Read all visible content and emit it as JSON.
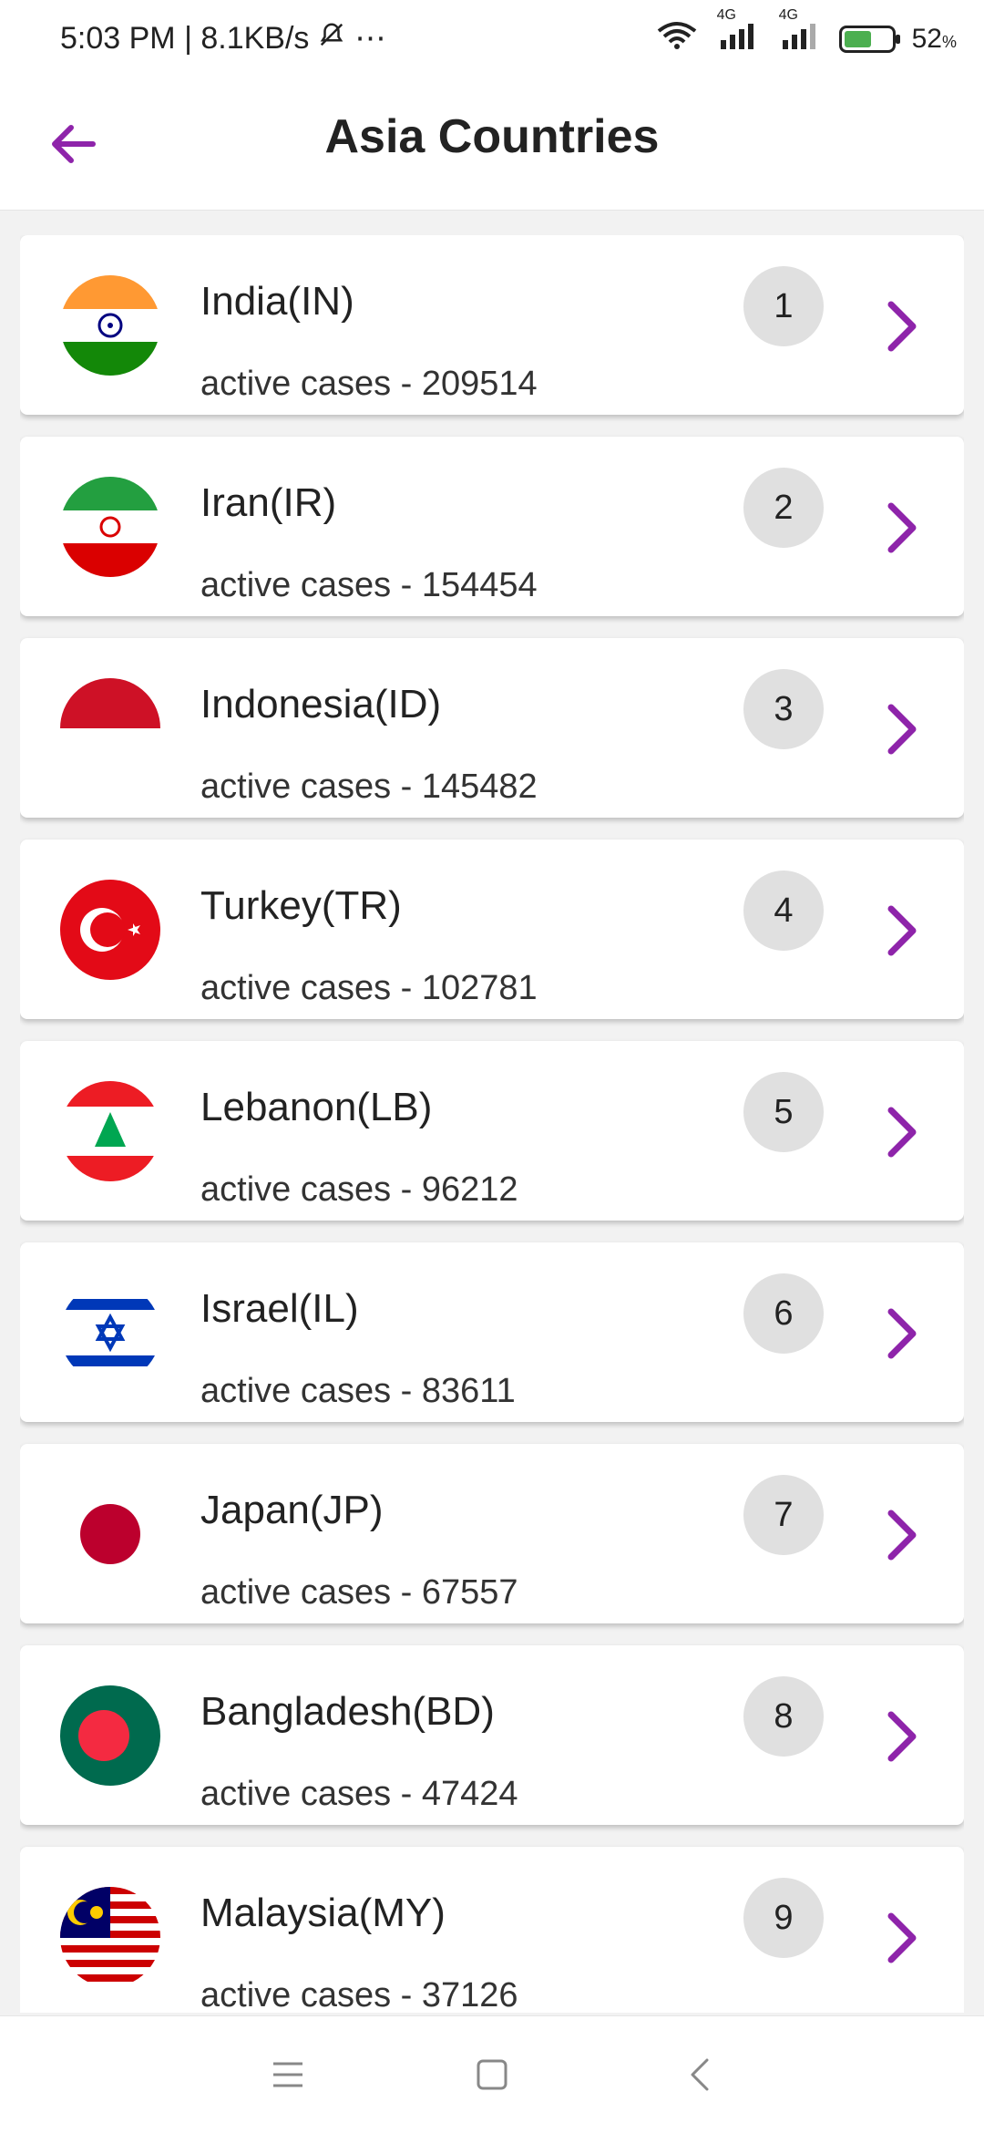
{
  "status": {
    "time": "5:03 PM | 8.1KB/s",
    "battery": "52",
    "network1": "4G",
    "network2": "4G"
  },
  "app_bar": {
    "title": "Asia Countries"
  },
  "countries": [
    {
      "name": "India(IN)",
      "active": "active cases - 209514",
      "rank": "1"
    },
    {
      "name": "Iran(IR)",
      "active": "active cases - 154454",
      "rank": "2"
    },
    {
      "name": "Indonesia(ID)",
      "active": "active cases - 145482",
      "rank": "3"
    },
    {
      "name": "Turkey(TR)",
      "active": "active cases - 102781",
      "rank": "4"
    },
    {
      "name": "Lebanon(LB)",
      "active": "active cases - 96212",
      "rank": "5"
    },
    {
      "name": "Israel(IL)",
      "active": "active cases - 83611",
      "rank": "6"
    },
    {
      "name": "Japan(JP)",
      "active": "active cases - 67557",
      "rank": "7"
    },
    {
      "name": "Bangladesh(BD)",
      "active": "active cases - 47424",
      "rank": "8"
    },
    {
      "name": "Malaysia(MY)",
      "active": "active cases - 37126",
      "rank": "9"
    }
  ],
  "colors": {
    "accent": "#8e24aa",
    "rank_bg": "#e0e0e0"
  },
  "icons": [
    "back-arrow-icon",
    "chevron-right-icon",
    "menu-icon",
    "home-square-icon",
    "back-nav-icon",
    "wifi-icon",
    "signal-icon",
    "battery-icon",
    "mute-bell-icon"
  ]
}
